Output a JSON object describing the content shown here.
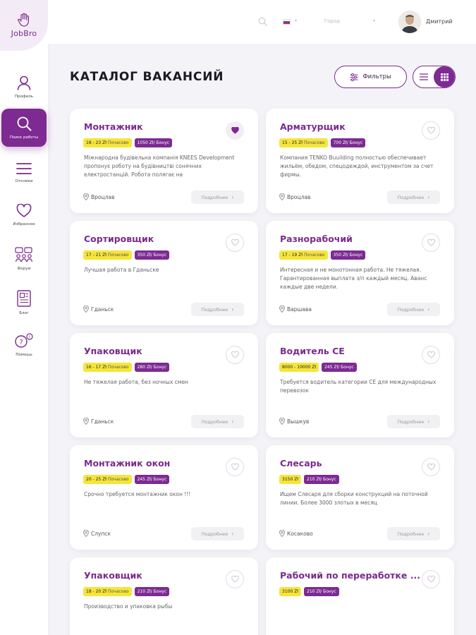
{
  "app": {
    "logo_text": "JobBro"
  },
  "colors": {
    "accent": "#7d2a93",
    "salary_badge": "#f6e53a",
    "title": "#7b2a8e"
  },
  "sidebar": {
    "items": [
      {
        "label": "Профиль",
        "icon": "user-icon"
      },
      {
        "label": "Поиск работы",
        "icon": "search-icon",
        "active": true
      },
      {
        "label": "Отклики",
        "icon": "menu-icon"
      },
      {
        "label": "Избранное",
        "icon": "heart-icon"
      },
      {
        "label": "Форум",
        "icon": "forum-icon"
      },
      {
        "label": "Блог",
        "icon": "blog-icon"
      },
      {
        "label": "Помощь",
        "icon": "help-icon"
      }
    ]
  },
  "header": {
    "city_placeholder": "Город",
    "user_name": "Дмитрий",
    "language_flag": "ru"
  },
  "page": {
    "title": "КАТАЛОГ ВАКАНСИЙ",
    "filter_label": "Фильтры",
    "view_mode": "grid"
  },
  "vacancies": [
    {
      "title": "Монтажник",
      "salary": "18 - 23 Zł",
      "salary_unit": "Почасово",
      "bonus": "1050 Zł/ Бонус",
      "favorite": true,
      "description": "Міжнародна будівельна компанія KNEES Development пропонує роботу на будівництві сонячних електростанцій. Робота полягає на",
      "location": "Вроцлав",
      "more_label": "Подробнее"
    },
    {
      "title": "Арматурщик",
      "salary": "15 - 25 Zł",
      "salary_unit": "Почасово",
      "bonus": "700 Zł/ Бонус",
      "favorite": false,
      "description": "Компания TENKO Buuilding полностью обеспечивает жильём, обедом, спецодеждой, инструментом за счет фирмы.",
      "location": "Вроцлав",
      "more_label": "Подробнее"
    },
    {
      "title": "Сортировщик",
      "salary": "17 - 21 Zł",
      "salary_unit": "Почасово",
      "bonus": "350 Zł/ Бонус",
      "favorite": false,
      "description": "Лучшая работа в Гданьске",
      "location": "Гданьск",
      "more_label": "Подробнее"
    },
    {
      "title": "Разнорабочий",
      "salary": "17 - 19 Zł",
      "salary_unit": "Почасово",
      "bonus": "350 Zł/ Бонус",
      "favorite": false,
      "description": "Интересная и не монотонная работа. Не тяжелая. Гарантированная выплата з/п каждый месяц. Аванс каждые две недели.",
      "location": "Варшава",
      "more_label": "Подробнее"
    },
    {
      "title": "Упаковщик",
      "salary": "16 - 17 Zł",
      "salary_unit": "Почасово",
      "bonus": "280 Zł/ Бонус",
      "favorite": false,
      "description": "Не тяжелая работа, без ночных смен",
      "location": "Гданьск",
      "more_label": "Подробнее"
    },
    {
      "title": "Водитель CE",
      "salary": "8000 - 10000 Zł",
      "salary_unit": "",
      "bonus": "245 Zł/ Бонус",
      "favorite": false,
      "description": "Требуется водитель категории CE для международных перевозок",
      "location": "Вышкув",
      "more_label": "Подробнее"
    },
    {
      "title": "Монтажник окон",
      "salary": "20 - 25 Zł",
      "salary_unit": "Почасово",
      "bonus": "245 Zł/ Бонус",
      "favorite": false,
      "description": "Срочно требуется монтажник окон !!!",
      "location": "Слупск",
      "more_label": "Подробнее"
    },
    {
      "title": "Слесарь",
      "salary": "3150 Zł",
      "salary_unit": "",
      "bonus": "210 Zł/ Бонус",
      "favorite": false,
      "description": "Ищем Слесаря для сборки конструкций на поточной линии. Более 3000 злотых в месяц",
      "location": "Косаково",
      "more_label": "Подробнее"
    },
    {
      "title": "Упаковщик",
      "salary": "18 - 20 Zł",
      "salary_unit": "Почасово",
      "bonus": "210 Zł/ Бонус",
      "favorite": false,
      "description": "Производство и упаковка рыбы",
      "location": "",
      "more_label": ""
    },
    {
      "title": "Рабочий по переработке ...",
      "salary": "3100 Zł",
      "salary_unit": "",
      "bonus": "210 Zł/ Бонус",
      "favorite": false,
      "description": "",
      "location": "",
      "more_label": ""
    }
  ]
}
